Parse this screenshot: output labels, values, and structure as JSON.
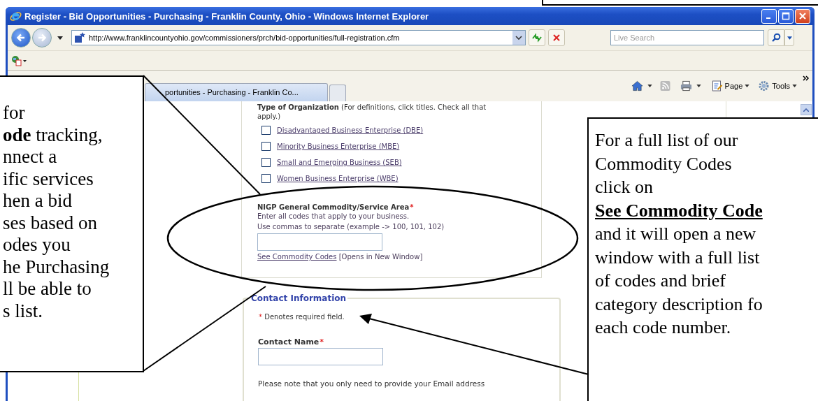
{
  "window": {
    "title": "Register - Bid Opportunities - Purchasing - Franklin County, Ohio - Windows Internet Explorer"
  },
  "address_bar": {
    "url": "http://www.franklincountyohio.gov/commissioners/prch/bid-opportunities/full-registration.cfm"
  },
  "search": {
    "placeholder": "Live Search"
  },
  "tabs": [
    {
      "label": "portunities - Purchasing - Franklin Co...",
      "selected": true
    }
  ],
  "command_bar": [
    {
      "label": "Page",
      "kind": "page"
    },
    {
      "label": "Tools",
      "kind": "tools"
    }
  ],
  "form": {
    "org_heading": "Type of Organization",
    "org_note": "(For definitions, click titles. Check all that apply.)",
    "org_types": [
      {
        "label": "Disadvantaged Business Enterprise (DBE)",
        "checked": false
      },
      {
        "label": "Minority Business Enterprise (MBE)",
        "checked": false
      },
      {
        "label": "Small and Emerging Business (SEB)",
        "checked": false
      },
      {
        "label": "Women Business Enterprise (WBE)",
        "checked": false
      }
    ],
    "commodity": {
      "label": "NIGP General Commodity/Service Area",
      "required_mark": "*",
      "hints": [
        "Enter all codes that apply to your business.",
        "Use commas to separate (example -> 100, 101, 102)"
      ],
      "link": "See Commodity Codes",
      "link_note": "[Opens in New Window]"
    },
    "contact": {
      "legend": "Contact Information",
      "required_note": {
        "mark": "*",
        "text": "Denotes required field."
      },
      "name_field": {
        "label": "Contact Name",
        "required_mark": "*"
      },
      "note": "Please note that you only need to provide your Email address"
    }
  },
  "callouts": [
    {
      "kind": "left",
      "lines": [
        "for",
        "**ode** tracking,",
        "nnect a",
        "ific services",
        "hen a bid",
        "ses based on",
        "odes you",
        "he Purchasing",
        "ll be able to",
        "s list."
      ]
    },
    {
      "kind": "right",
      "lines": [
        "For a full list of our",
        "Commodity Codes",
        "click on",
        "**See Commodity Code**",
        "and it will open a new",
        "window with a full list",
        "of codes and brief",
        "category description fo",
        "each code number."
      ]
    }
  ]
}
